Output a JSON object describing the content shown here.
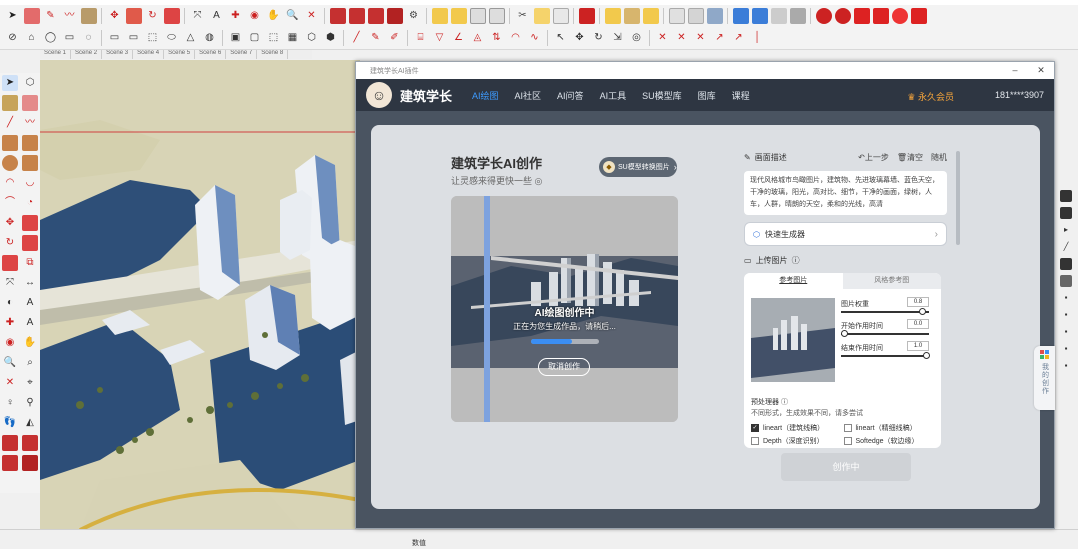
{
  "menubar": {
    "items": [
      "",
      "",
      "",
      "",
      "",
      "",
      "",
      "",
      "",
      "",
      "",
      "",
      "",
      "",
      "",
      "",
      "",
      "",
      "",
      "",
      "",
      "",
      "",
      ""
    ]
  },
  "scene_tabs": [
    "Scene 1",
    "Scene 2",
    "Scene 3",
    "Scene 4",
    "Scene 5",
    "Scene 6",
    "Scene 7",
    "Scene 8"
  ],
  "dialog": {
    "window_title": "建筑学长AI插件",
    "brand": "建筑学长",
    "nav": [
      "AI绘图",
      "AI社区",
      "AI问答",
      "AI工具",
      "SU模型库",
      "图库",
      "课程"
    ],
    "vip_label": "永久会员",
    "phone": "181****3907",
    "title": "建筑学长AI创作",
    "subtitle": "让灵感来得更快一些",
    "gen_button": "SU模型转换图片",
    "status_main": "AI绘图创作中",
    "status_sub": "正在为您生成作品，请稍后...",
    "progress": 0.6,
    "cancel": "取消创作",
    "desc_label": "画面描述",
    "desc_actions": [
      "上一步",
      "清空",
      "随机"
    ],
    "desc_text": "现代风格城市鸟瞰图片，建筑物、先进玻璃幕墙、蓝色天空，干净的玻璃，阳光，高对比、细节，干净的画面，绿树，人车，人群，晴朗的天空，柔和的光线，高清",
    "prompt_label": "快速生成器",
    "ctl_label": "上传图片",
    "ctl_tabs": [
      "参考图片",
      "风格参考图"
    ],
    "sliders": [
      {
        "label": "图片权重",
        "value": "0.8",
        "pos": 0.95
      },
      {
        "label": "开始作用时间",
        "value": "0.0",
        "pos": 0.0
      },
      {
        "label": "结束作用时间",
        "value": "1.0",
        "pos": 1.0
      }
    ],
    "pre_title": "预处理器",
    "pre_sub": "不同形式，生成效果不同，请多尝试",
    "preprocessors": [
      {
        "label": "lineart（建筑线稿）",
        "checked": true
      },
      {
        "label": "lineart（精细线稿）",
        "checked": false
      },
      {
        "label": "Depth（深度识别）",
        "checked": false
      },
      {
        "label": "Softedge（软边缘）",
        "checked": false
      }
    ],
    "create_button": "创作中",
    "side_tab": "我的创作"
  },
  "statusbar": {
    "value_label": "数值"
  },
  "colors": {
    "accent": "#3d9bff",
    "vip": "#f7a53b",
    "nav_bg": "#2e3642",
    "window_bg": "#4a5461"
  }
}
